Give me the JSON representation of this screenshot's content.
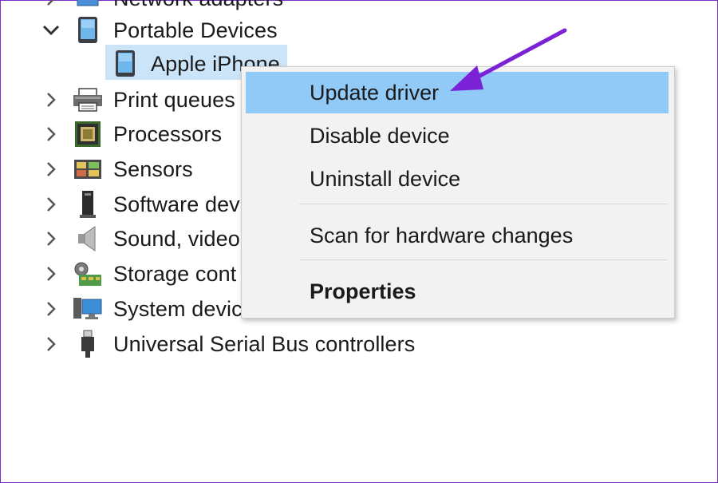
{
  "tree": {
    "cut_item": {
      "label": "Network adapters",
      "icon": "network-adapter-icon"
    },
    "parent": {
      "label": "Portable Devices",
      "icon": "portable-device-icon",
      "expanded": true
    },
    "child": {
      "label": "Apple iPhone",
      "icon": "phone-icon",
      "selected": true
    },
    "items": [
      {
        "label": "Print queues",
        "icon": "printer-icon"
      },
      {
        "label": "Processors",
        "icon": "processor-icon"
      },
      {
        "label": "Sensors",
        "icon": "sensor-icon"
      },
      {
        "label": "Software dev",
        "icon": "software-device-icon"
      },
      {
        "label": "Sound, video",
        "icon": "speaker-icon"
      },
      {
        "label": "Storage cont",
        "icon": "storage-controller-icon"
      },
      {
        "label": "System devic",
        "icon": "system-device-icon"
      },
      {
        "label": "Universal Serial Bus controllers",
        "icon": "usb-icon"
      }
    ]
  },
  "context_menu": {
    "update_driver": "Update driver",
    "disable_device": "Disable device",
    "uninstall_device": "Uninstall device",
    "scan_hardware": "Scan for hardware changes",
    "properties": "Properties",
    "highlight_color": "#91c9f7"
  },
  "annotation": {
    "arrow_color": "#7b22d6",
    "frame_color": "#7a2fc9"
  }
}
